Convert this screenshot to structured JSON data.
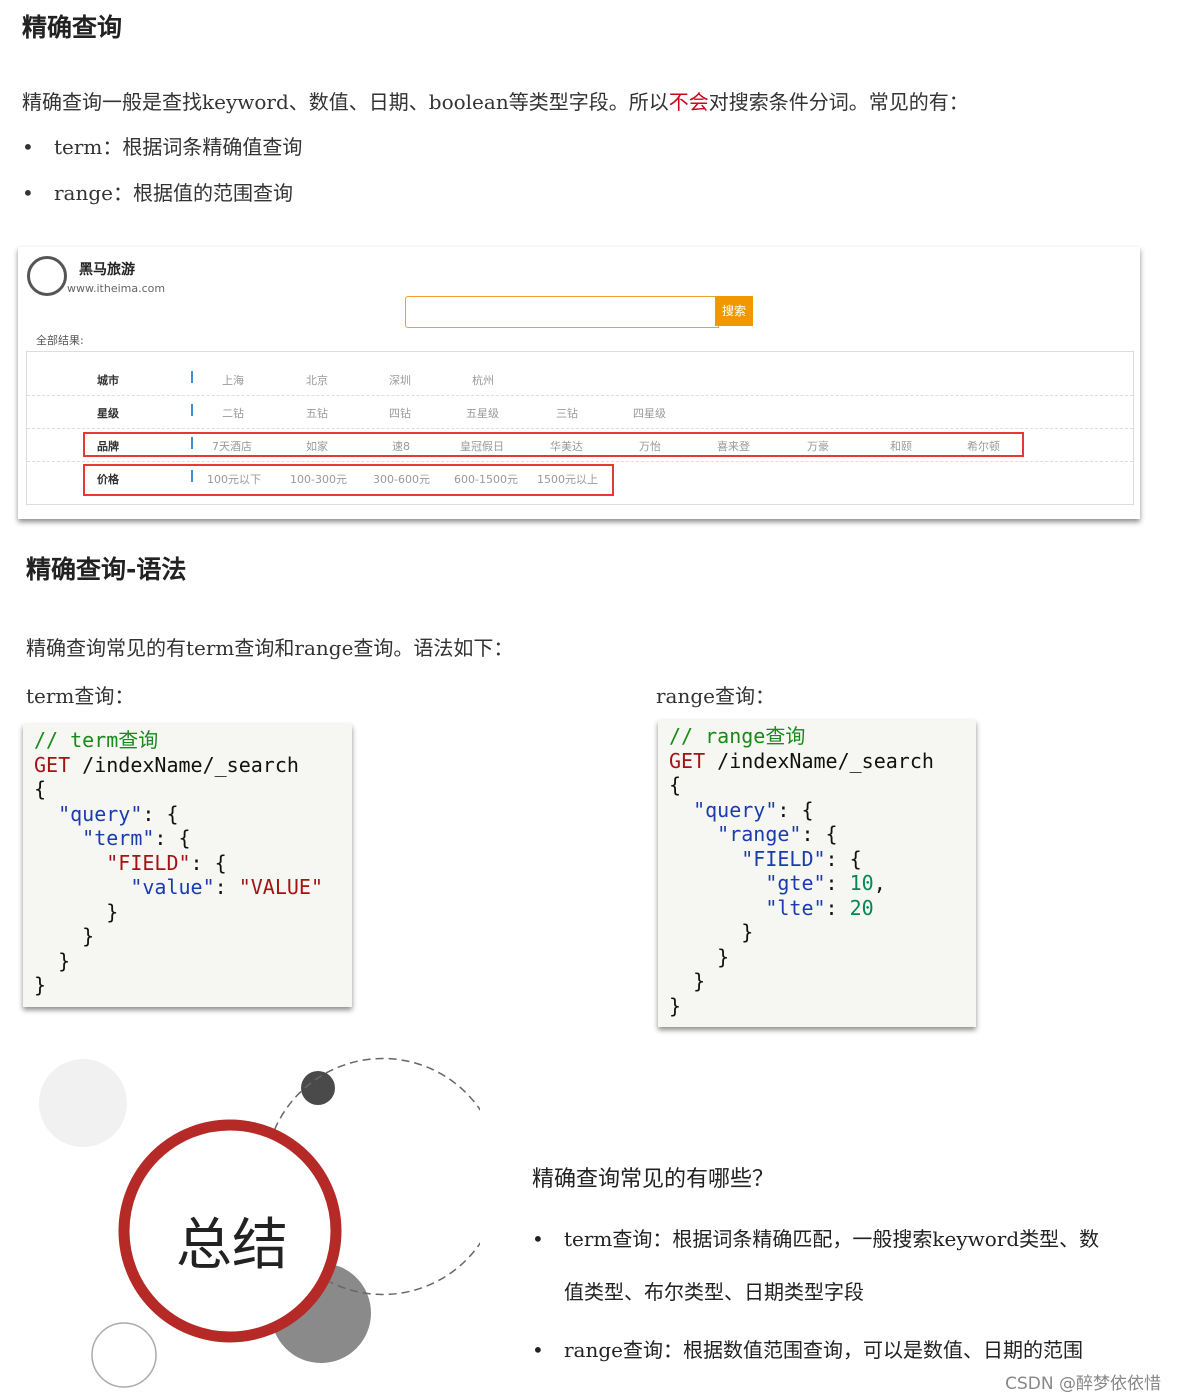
{
  "section1": {
    "title": "精确查询",
    "intro_before": "精确查询一般是查找keyword、数值、日期、boolean等类型字段。所以",
    "intro_red": "不会",
    "intro_after": "对搜索条件分词。常见的有：",
    "bullets": [
      {
        "dot": "•",
        "text": "term：根据词条精确值查询"
      },
      {
        "dot": "•",
        "text": "range：根据值的范围查询"
      }
    ]
  },
  "screenshot": {
    "logo_title": "黑马旅游",
    "logo_url": "www.itheima.com",
    "search_button": "搜索",
    "search_value": "",
    "all_results": "全部结果:",
    "rows": [
      {
        "label": "城市",
        "options": [
          "上海",
          "北京",
          "深圳",
          "杭州"
        ]
      },
      {
        "label": "星级",
        "options": [
          "二钻",
          "五钻",
          "四钻",
          "五星级",
          "三钻",
          "四星级"
        ]
      },
      {
        "label": "品牌",
        "options": [
          "7天酒店",
          "如家",
          "速8",
          "皇冠假日",
          "华美达",
          "万怡",
          "喜来登",
          "万豪",
          "和颐",
          "希尔顿"
        ]
      },
      {
        "label": "价格",
        "options": [
          "100元以下",
          "100-300元",
          "300-600元",
          "600-1500元",
          "1500元以上"
        ]
      }
    ]
  },
  "section2": {
    "title": "精确查询-语法",
    "intro": "精确查询常见的有term查询和range查询。语法如下：",
    "term_label": "term查询：",
    "range_label": "range查询："
  },
  "term_code": {
    "comment": "// term查询",
    "method": "GET",
    "path": " /indexName/_search",
    "open": "{",
    "query_key": "\"query\"",
    "term_key": "\"term\"",
    "field_key": "\"FIELD\"",
    "value_key": "\"value\"",
    "value_val": "\"VALUE\"",
    "close": "}"
  },
  "range_code": {
    "comment": "// range查询",
    "method": "GET",
    "path": " /indexName/_search",
    "open": "{",
    "query_key": "\"query\"",
    "range_key": "\"range\"",
    "field_key": "\"FIELD\"",
    "gte_key": "\"gte\"",
    "gte_val": "10",
    "lte_key": "\"lte\"",
    "lte_val": "20",
    "close": "}"
  },
  "summary": {
    "badge": "总结",
    "question": "精确查询常见的有哪些？",
    "items": [
      {
        "dot": "•",
        "line1": "term查询：根据词条精确匹配，一般搜索keyword类型、数",
        "line2": "值类型、布尔类型、日期类型字段"
      },
      {
        "dot": "•",
        "line1": "range查询：根据数值范围查询，可以是数值、日期的范围",
        "line2": ""
      }
    ],
    "colors": {
      "ring": "#b52a26",
      "dark_dot": "#4a4a4a",
      "gray_circle": "#8a8a8a",
      "light_circle": "#f1f1f1"
    }
  },
  "watermark": "CSDN @醉梦依依惜"
}
